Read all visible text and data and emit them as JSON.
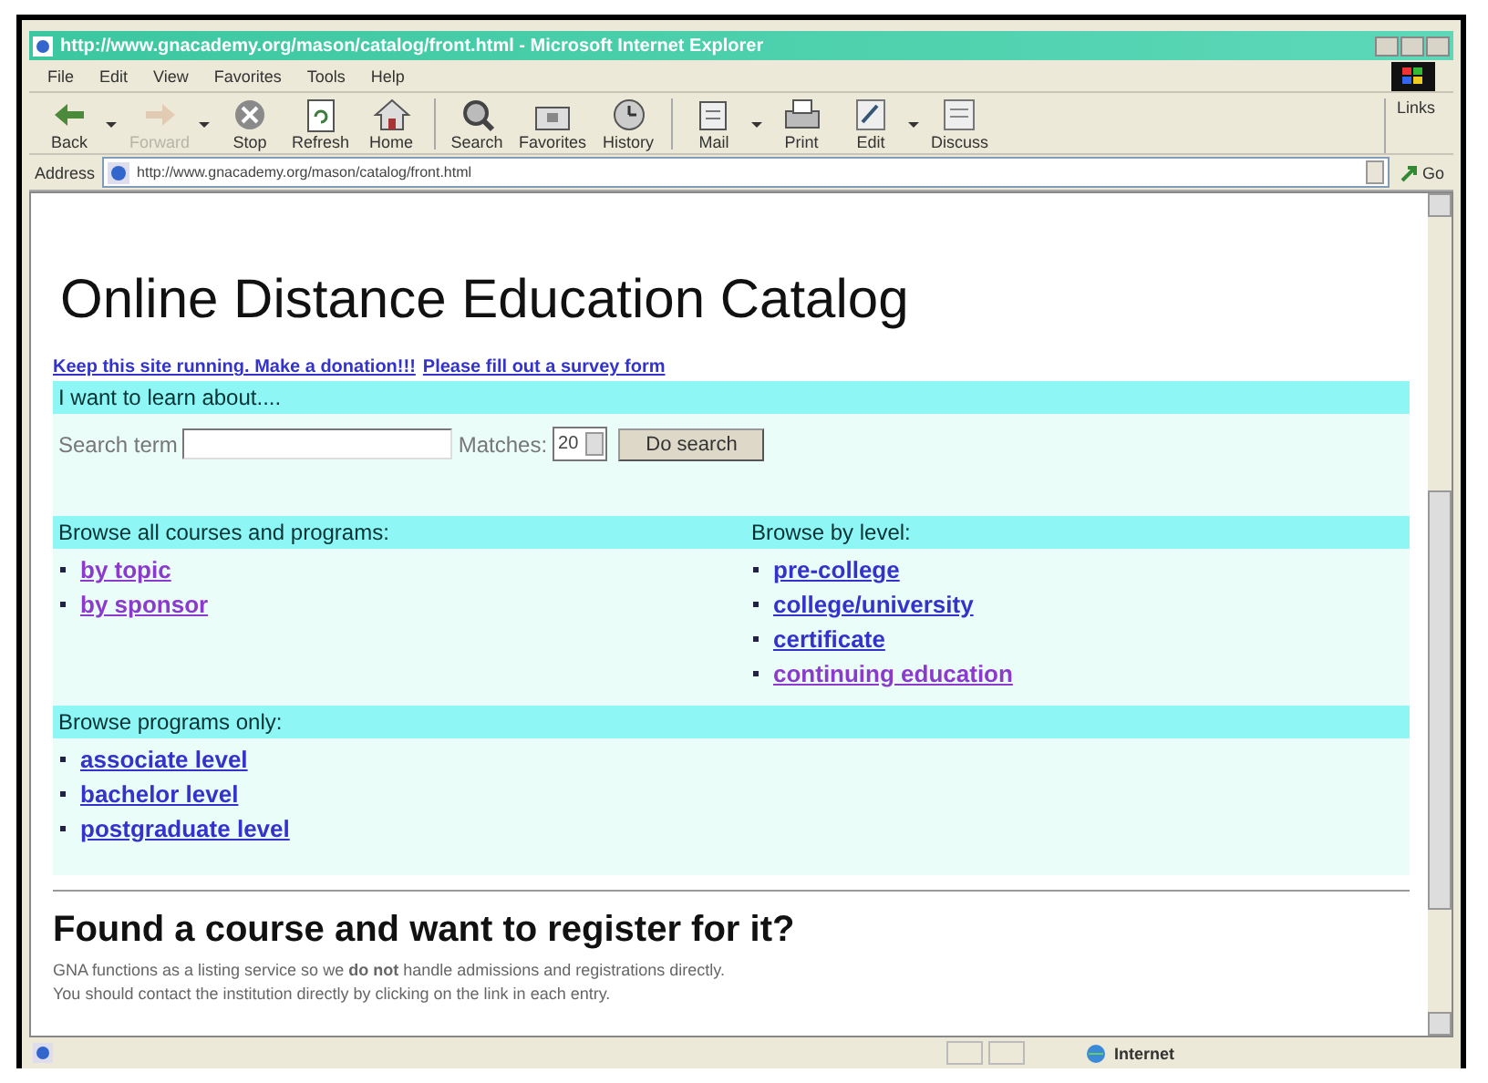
{
  "window": {
    "title": "http://www.gnacademy.org/mason/catalog/front.html - Microsoft Internet Explorer"
  },
  "menu": [
    "File",
    "Edit",
    "View",
    "Favorites",
    "Tools",
    "Help"
  ],
  "toolbar": [
    {
      "label": "Back",
      "disabled": false,
      "has_menu": true
    },
    {
      "label": "Forward",
      "disabled": true,
      "has_menu": true
    },
    {
      "label": "Stop",
      "disabled": false,
      "has_menu": false
    },
    {
      "label": "Refresh",
      "disabled": false,
      "has_menu": false
    },
    {
      "label": "Home",
      "disabled": false,
      "has_menu": false
    },
    {
      "label": "Search",
      "disabled": false,
      "has_menu": false
    },
    {
      "label": "Favorites",
      "disabled": false,
      "has_menu": false
    },
    {
      "label": "History",
      "disabled": false,
      "has_menu": false
    },
    {
      "label": "Mail",
      "disabled": false,
      "has_menu": true
    },
    {
      "label": "Print",
      "disabled": false,
      "has_menu": false
    },
    {
      "label": "Edit",
      "disabled": false,
      "has_menu": true
    },
    {
      "label": "Discuss",
      "disabled": false,
      "has_menu": false
    }
  ],
  "links_label": "Links",
  "address": {
    "label": "Address",
    "value": "http://www.gnacademy.org/mason/catalog/front.html",
    "go": "Go"
  },
  "page": {
    "heading": "Online Distance Education Catalog",
    "top_links": [
      {
        "text": "Keep this site running. Make a donation!!!",
        "visited": false
      },
      {
        "text": "Please fill out a survey form",
        "visited": false
      }
    ],
    "search": {
      "header": "I want to learn about....",
      "term_label": "Search term",
      "matches_label": "Matches:",
      "matches_value": "20",
      "button": "Do search"
    },
    "columns": [
      {
        "header": "Browse all courses and programs:",
        "links": [
          {
            "text": "by topic",
            "visited": true
          },
          {
            "text": "by sponsor",
            "visited": true
          }
        ]
      },
      {
        "header": "Browse by level:",
        "links": [
          {
            "text": "pre-college",
            "visited": false
          },
          {
            "text": "college/university",
            "visited": false
          },
          {
            "text": "certificate",
            "visited": false
          },
          {
            "text": "continuing education",
            "visited": true
          }
        ]
      }
    ],
    "programs": {
      "header": "Browse programs only:",
      "links": [
        {
          "text": "associate level",
          "visited": false
        },
        {
          "text": "bachelor level",
          "visited": false
        },
        {
          "text": "postgraduate level",
          "visited": false
        }
      ]
    },
    "register": {
      "heading": "Found a course and want to register for it?",
      "paragraphs": [
        "GNA functions as a listing service so we **do not** handle admissions and registrations directly.",
        "You should contact the institution directly by clicking on the link in each entry."
      ]
    }
  },
  "status_bar": {
    "zone": "Internet"
  }
}
